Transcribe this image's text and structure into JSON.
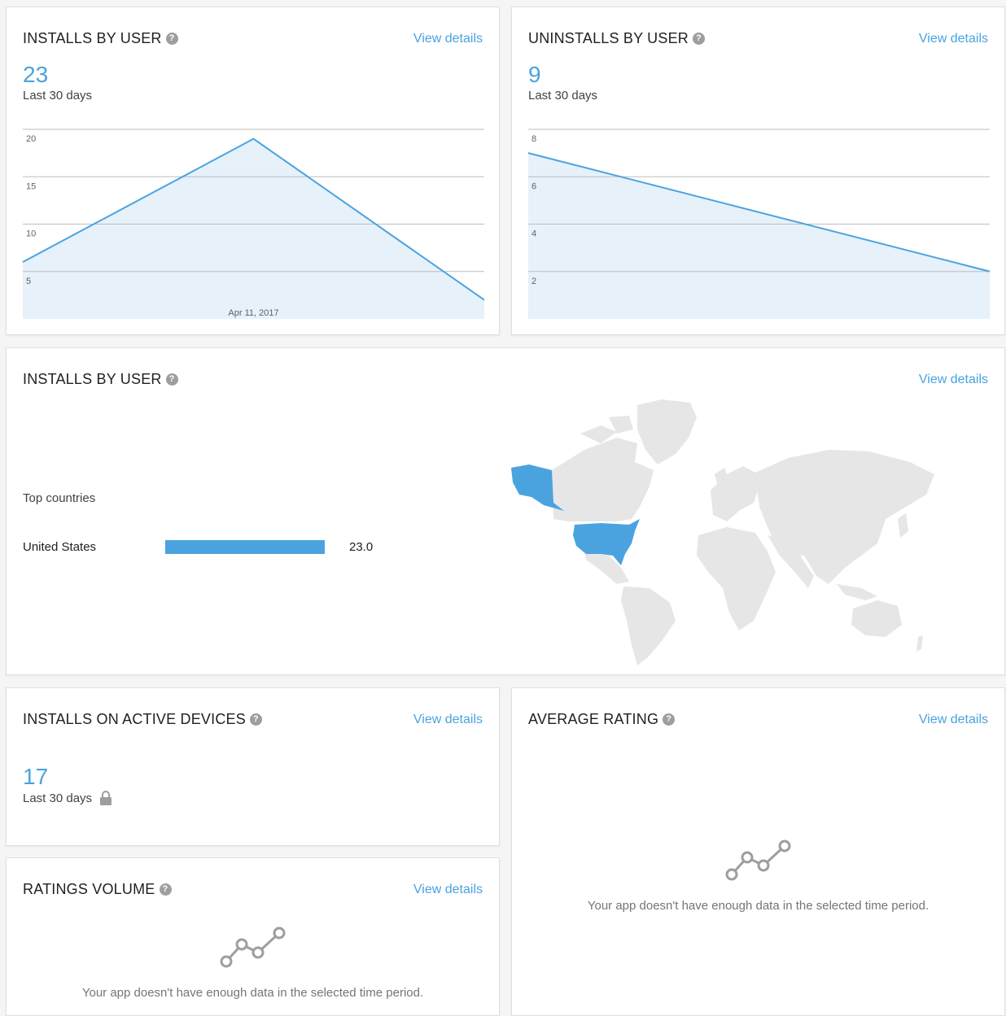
{
  "installs_card": {
    "title": "INSTALLS BY USER",
    "help": "?",
    "view_details": "View details",
    "value": "23",
    "period": "Last 30 days",
    "chart_data": {
      "type": "area",
      "x": [
        "",
        "Apr 11, 2017",
        ""
      ],
      "values": [
        6,
        19,
        2
      ],
      "y_ticks": [
        "5",
        "10",
        "15",
        "20"
      ],
      "x_label": "Apr 11, 2017",
      "ylim": [
        0,
        20
      ],
      "grid": true,
      "line_color": "#4aa3df",
      "fill_color": "#e3f0fa"
    }
  },
  "uninstalls_card": {
    "title": "UNINSTALLS BY USER",
    "help": "?",
    "view_details": "View details",
    "value": "9",
    "period": "Last 30 days",
    "chart_data": {
      "type": "area",
      "values": [
        7,
        2
      ],
      "y_ticks": [
        "2",
        "4",
        "6",
        "8"
      ],
      "ylim": [
        0,
        8
      ],
      "grid": true,
      "line_color": "#4aa3df",
      "fill_color": "#e3f0fa"
    }
  },
  "geo_card": {
    "title": "INSTALLS BY USER",
    "help": "?",
    "view_details": "View details",
    "top_countries_label": "Top countries",
    "countries": [
      {
        "name": "United States",
        "value": "23.0",
        "share": 1.0
      }
    ],
    "highlight_color": "#4aa3df",
    "map_color": "#e6e6e6"
  },
  "active_devices_card": {
    "title": "INSTALLS ON ACTIVE DEVICES",
    "help": "?",
    "view_details": "View details",
    "value": "17",
    "period": "Last 30 days",
    "icon": "lock-icon"
  },
  "ratings_volume_card": {
    "title": "RATINGS VOLUME",
    "help": "?",
    "view_details": "View details",
    "empty_message": "Your app doesn't have enough data in the selected time period.",
    "icon": "line-chart-icon"
  },
  "average_rating_card": {
    "title": "AVERAGE RATING",
    "help": "?",
    "view_details": "View details",
    "empty_message": "Your app doesn't have enough data in the selected time period.",
    "icon": "line-chart-icon"
  }
}
